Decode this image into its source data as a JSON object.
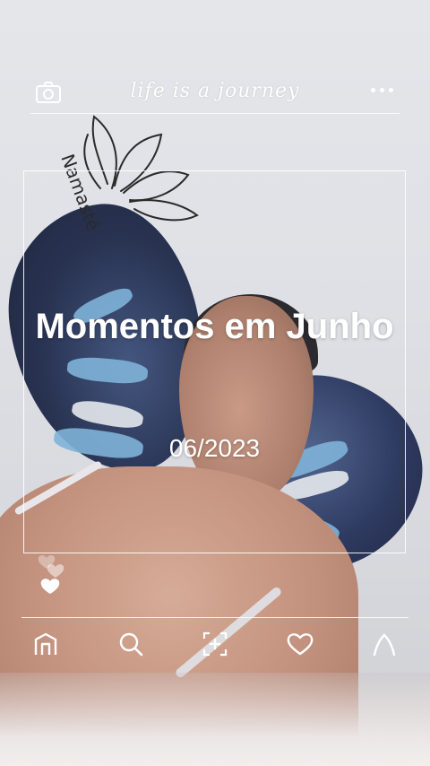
{
  "header": {
    "tagline": "life is a journey",
    "camera_icon": "camera-icon",
    "more_icon": "more-horizontal-icon"
  },
  "story": {
    "title": "Momentos em Junho",
    "date": "06/2023"
  },
  "wall_sign": {
    "text": "Namastê"
  },
  "reactions": {
    "icon": "hearts-icon"
  },
  "bottom_nav": {
    "items": [
      {
        "icon": "home-icon"
      },
      {
        "icon": "search-icon"
      },
      {
        "icon": "add-icon"
      },
      {
        "icon": "heart-icon"
      },
      {
        "icon": "profile-icon"
      }
    ]
  },
  "colors": {
    "overlay": "#ffffff",
    "wing_dark": "#1f2a4a",
    "wing_accent": "#7fb2d8"
  }
}
